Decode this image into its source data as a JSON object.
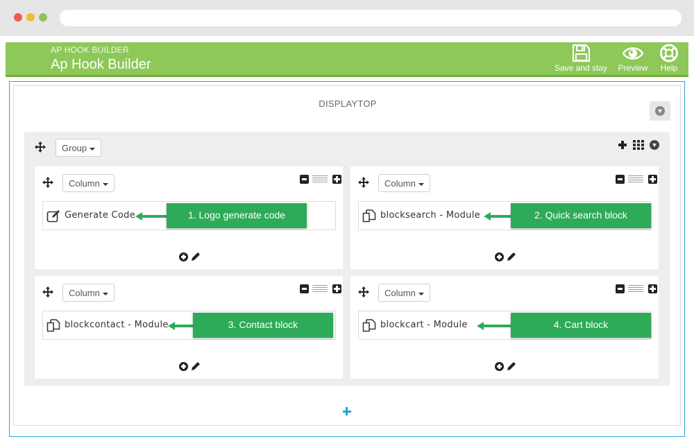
{
  "header": {
    "subtitle": "AP HOOK BUILDER",
    "title": "Ap Hook Builder",
    "buttons": [
      {
        "label": "Save and stay",
        "icon": "floppy-disk-icon"
      },
      {
        "label": "Preview",
        "icon": "eye-icon"
      },
      {
        "label": "Help",
        "icon": "lifebuoy-icon"
      }
    ]
  },
  "hook": {
    "name": "DISPLAYTOP",
    "group": {
      "dropdown_label": "Group",
      "columns": [
        {
          "dropdown_label": "Column",
          "widget_label": "Generate Code",
          "widget_icon": "edit-icon",
          "callout": "1. Logo generate code"
        },
        {
          "dropdown_label": "Column",
          "widget_label": "blocksearch - Module",
          "widget_icon": "copy-icon",
          "callout": "2. Quick search block"
        },
        {
          "dropdown_label": "Column",
          "widget_label": "blockcontact - Module",
          "widget_icon": "copy-icon",
          "callout": "3. Contact block"
        },
        {
          "dropdown_label": "Column",
          "widget_label": "blockcart - Module",
          "widget_icon": "copy-icon",
          "callout": "4. Cart block"
        }
      ]
    }
  },
  "colors": {
    "header_green": "#8dc858",
    "callout_green": "#2eab58",
    "frame_blue": "#29a7d8",
    "add_blue": "#23a3dd"
  }
}
